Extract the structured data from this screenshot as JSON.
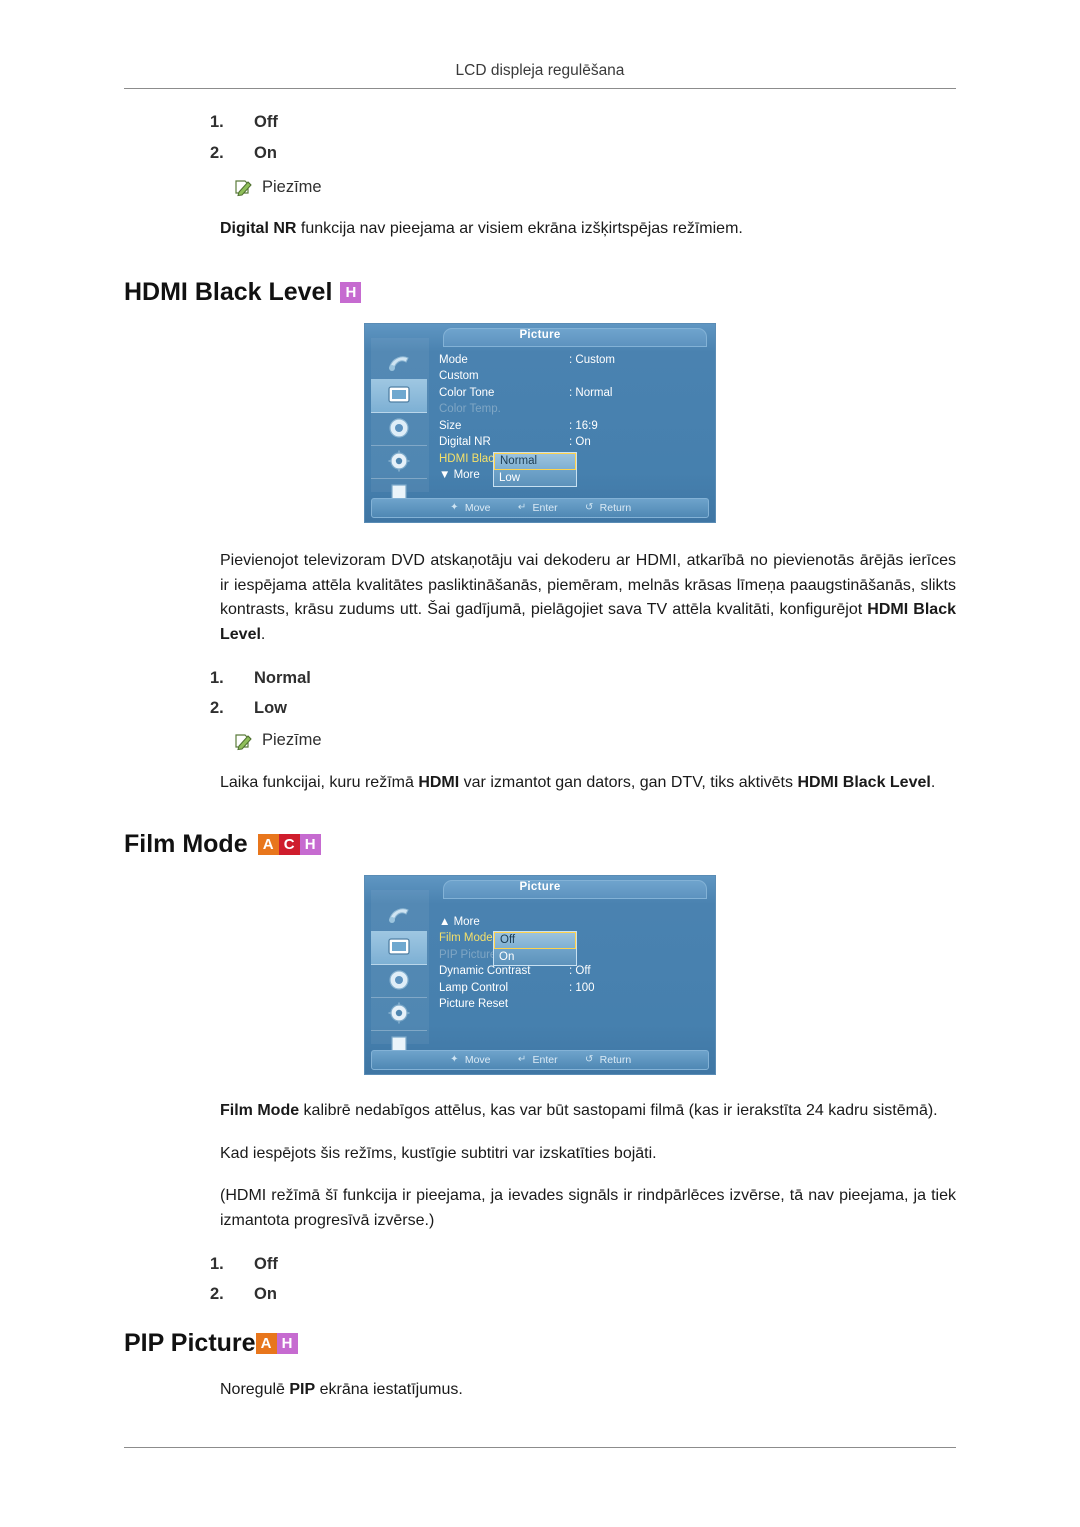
{
  "header": {
    "title": "LCD displeja regulēšana"
  },
  "top_list": [
    {
      "num": "1.",
      "label": "Off"
    },
    {
      "num": "2.",
      "label": "On"
    }
  ],
  "note1": {
    "label": "Piezīme",
    "icon": "note-pencil-icon"
  },
  "note1_text_bold": "Digital NR",
  "note1_text_rest": " funkcija nav pieejama ar visiem ekrāna izšķirtspējas režīmiem.",
  "sections": {
    "hdmi_black_level": {
      "title": "HDMI Black Level",
      "tags": [
        "H"
      ],
      "osd": {
        "title": "Picture",
        "rows": [
          {
            "label": "Mode",
            "value": ": Custom",
            "state": "normal"
          },
          {
            "label": "Custom",
            "value": "",
            "state": "normal"
          },
          {
            "label": "Color Tone",
            "value": ": Normal",
            "state": "normal"
          },
          {
            "label": "Color Temp.",
            "value": "",
            "state": "dim"
          },
          {
            "label": "Size",
            "value": ": 16:9",
            "state": "normal"
          },
          {
            "label": "Digital NR",
            "value": ": On",
            "state": "normal"
          },
          {
            "label": "HDMI Black Level",
            "value": "",
            "state": "highlight"
          },
          {
            "label": "▼ More",
            "value": "",
            "state": "normal"
          }
        ],
        "dropdown": {
          "items": [
            "Normal",
            "Low"
          ],
          "selected": "Normal"
        },
        "footer": [
          {
            "glyph": "✦",
            "label": "Move"
          },
          {
            "glyph": "↵",
            "label": "Enter"
          },
          {
            "glyph": "↺",
            "label": "Return"
          }
        ]
      },
      "body": "Pievienojot televizoram DVD atskaņotāju vai dekoderu ar HDMI, atkarībā no pievienotās ārējās ierīces ir iespējama attēla kvalitātes pasliktināšanās, piemēram, melnās krāsas līmeņa paaugstināšanās, slikts kontrasts, krāsu zudums utt. Šai gadījumā, pielāgojiet sava TV attēla kvalitāti, konfigurējot ",
      "body_bold": "HDMI Black Level",
      "body_end": ".",
      "list": [
        {
          "num": "1.",
          "label": "Normal"
        },
        {
          "num": "2.",
          "label": "Low"
        }
      ],
      "note": {
        "label": "Piezīme"
      },
      "note_text_parts": [
        {
          "text": "Laika funkcijai, kuru režīmā ",
          "bold": false
        },
        {
          "text": "HDMI",
          "bold": true
        },
        {
          "text": " var izmantot gan dators, gan DTV, tiks aktivēts ",
          "bold": false
        },
        {
          "text": "HDMI Black Level",
          "bold": true
        },
        {
          "text": ".",
          "bold": false
        }
      ]
    },
    "film_mode": {
      "title": "Film Mode",
      "tags": [
        "A",
        "C",
        "H"
      ],
      "osd": {
        "title": "Picture",
        "rows": [
          {
            "label": "▲ More",
            "value": "",
            "state": "normal"
          },
          {
            "label": "Film Mode",
            "value": "",
            "state": "highlight"
          },
          {
            "label": "PIP Picture",
            "value": "",
            "state": "dim"
          },
          {
            "label": "Dynamic Contrast",
            "value": ": Off",
            "state": "normal"
          },
          {
            "label": "Lamp Control",
            "value": ": 100",
            "state": "normal"
          },
          {
            "label": "Picture Reset",
            "value": "",
            "state": "normal"
          }
        ],
        "dropdown": {
          "items": [
            "Off",
            "On"
          ],
          "selected": "Off"
        },
        "footer": [
          {
            "glyph": "✦",
            "label": "Move"
          },
          {
            "glyph": "↵",
            "label": "Enter"
          },
          {
            "glyph": "↺",
            "label": "Return"
          }
        ]
      },
      "paragraphs": [
        {
          "bold_lead": "Film Mode",
          "text": " kalibrē nedabīgos attēlus, kas var būt sastopami filmā (kas ir ierakstīta 24 kadru sistēmā)."
        },
        {
          "bold_lead": "",
          "text": "Kad iespējots šis režīms, kustīgie subtitri var izskatīties bojāti."
        },
        {
          "bold_lead": "",
          "text": "(HDMI režīmā šī funkcija ir pieejama, ja ievades signāls ir rindpārlēces izvērse, tā nav pieejama, ja tiek izmantota progresīvā izvērse.)"
        }
      ],
      "list": [
        {
          "num": "1.",
          "label": "Off"
        },
        {
          "num": "2.",
          "label": "On"
        }
      ]
    },
    "pip_picture": {
      "title": "PIP Picture",
      "tags": [
        "A",
        "H"
      ],
      "body_pre": "Noregulē ",
      "body_bold": "PIP",
      "body_post": " ekrāna iestatījumus."
    }
  },
  "colors": {
    "tag_a": "#e8761c",
    "tag_c": "#cf1d2d",
    "tag_h": "#c66bd0",
    "osd_blue": "#3d7cab",
    "highlight_yellow": "#f4e06a"
  }
}
